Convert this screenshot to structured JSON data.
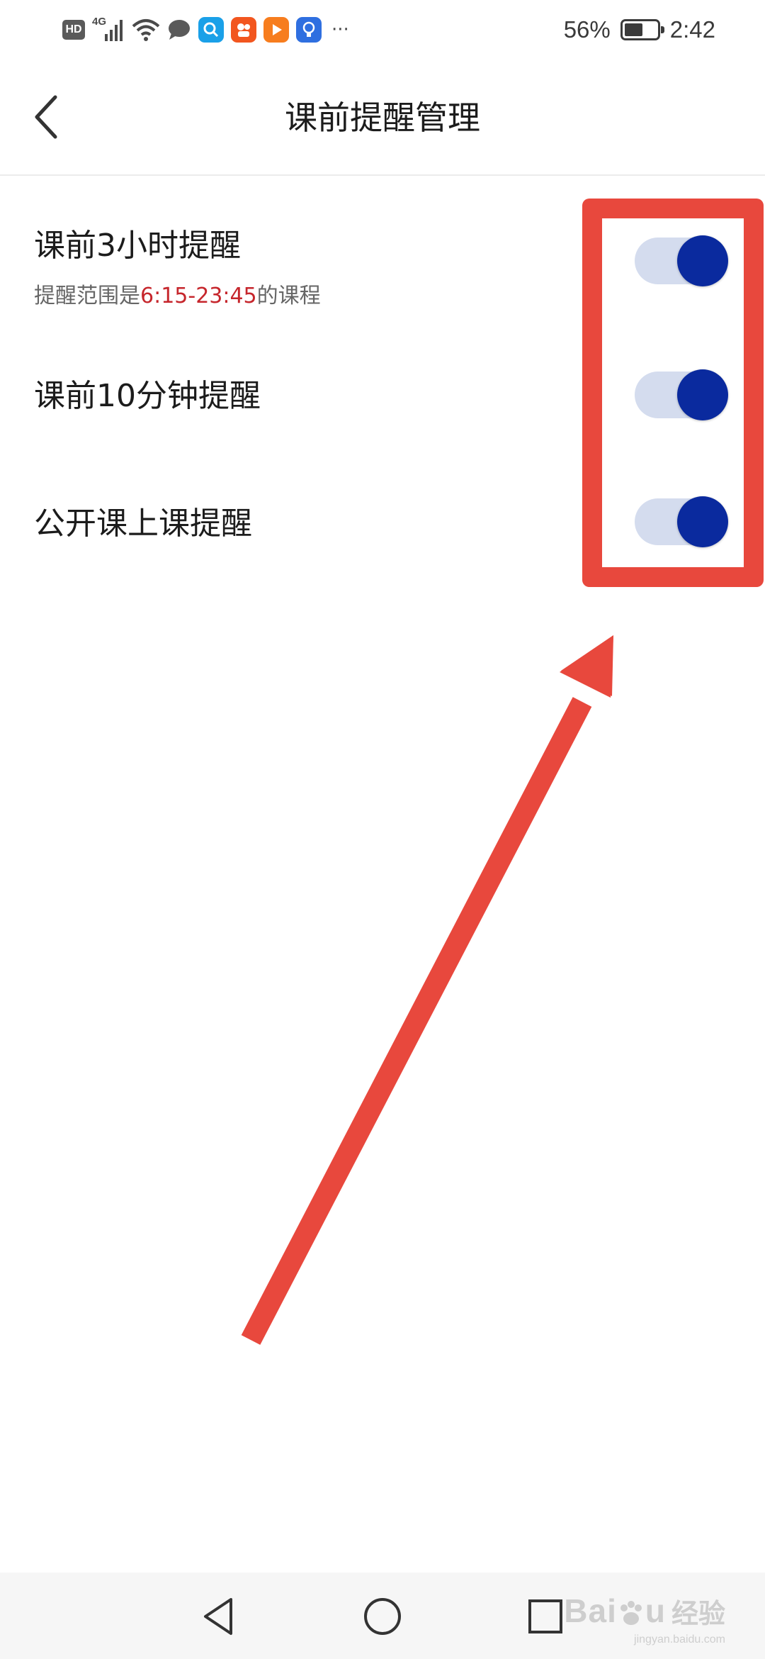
{
  "status_bar": {
    "hd": "HD",
    "network": "4G",
    "battery_percent": "56%",
    "battery_level": 0.56,
    "time": "2:42",
    "more": "···"
  },
  "header": {
    "title": "课前提醒管理",
    "back_icon": "chevron-left-icon"
  },
  "settings": [
    {
      "label": "课前3小时提醒",
      "description_prefix": "提醒范围是",
      "description_highlight": "6:15-23:45",
      "description_suffix": "的课程",
      "enabled": true
    },
    {
      "label": "课前10分钟提醒",
      "enabled": true
    },
    {
      "label": "公开课上课提醒",
      "enabled": true
    }
  ],
  "colors": {
    "toggle_on_knob": "#0a2a9e",
    "toggle_on_track": "#d4dcee",
    "highlight_text": "#c6262c",
    "annotation": "#e8483d"
  },
  "nav_bar": {
    "back_icon": "triangle-back-icon",
    "home_icon": "circle-home-icon",
    "recents_icon": "square-recents-icon"
  },
  "watermark": {
    "brand": "Bai",
    "brand_tail": "u",
    "sub": "经验",
    "url": "jingyan.baidu.com"
  }
}
